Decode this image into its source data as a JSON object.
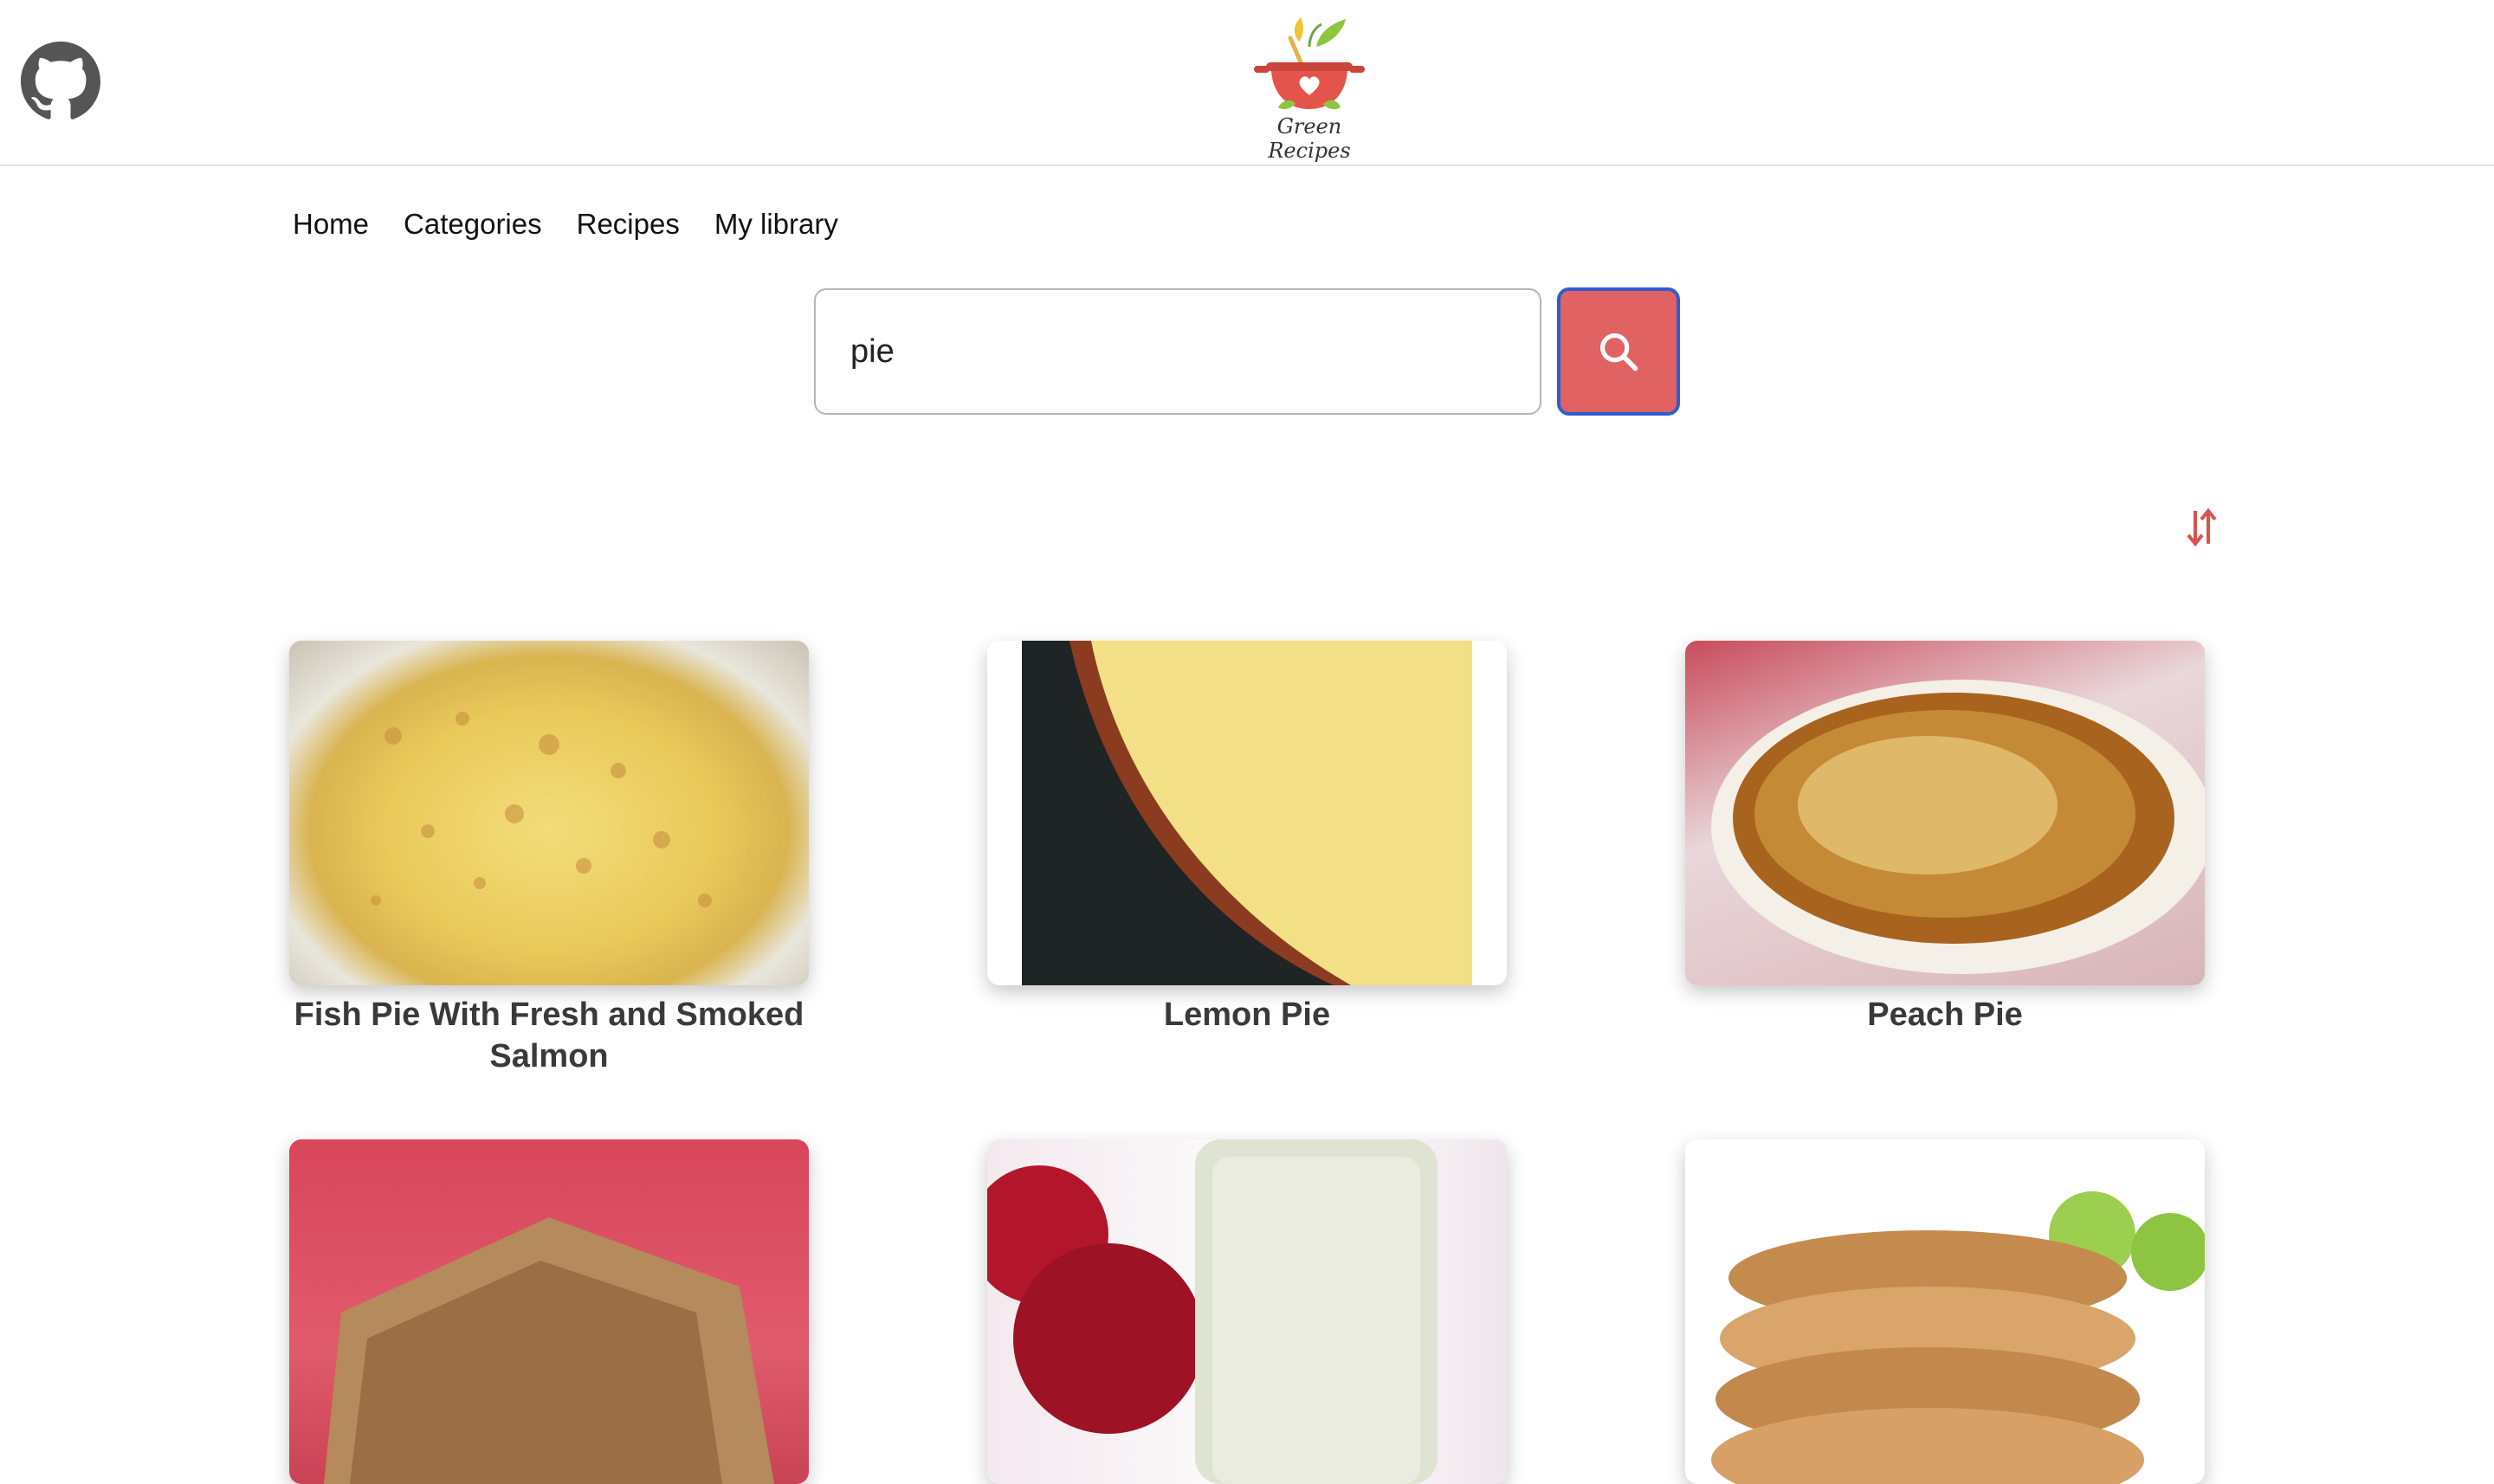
{
  "header": {
    "logo_text": "Green Recipes",
    "icons": {
      "github": "github-icon",
      "logo": "cooking-pot-logo"
    }
  },
  "nav": {
    "items": [
      {
        "label": "Home"
      },
      {
        "label": "Categories"
      },
      {
        "label": "Recipes"
      },
      {
        "label": "My library"
      }
    ]
  },
  "search": {
    "value": "pie",
    "placeholder": "",
    "button_icon": "search-icon",
    "button_color": "#e06262"
  },
  "sort": {
    "icon": "sort-arrows-icon",
    "color": "#d9534f"
  },
  "recipes": [
    {
      "title": "Fish Pie With Fresh and Smoked Salmon"
    },
    {
      "title": "Lemon Pie"
    },
    {
      "title": "Peach Pie"
    },
    {
      "title": ""
    },
    {
      "title": ""
    },
    {
      "title": ""
    }
  ]
}
